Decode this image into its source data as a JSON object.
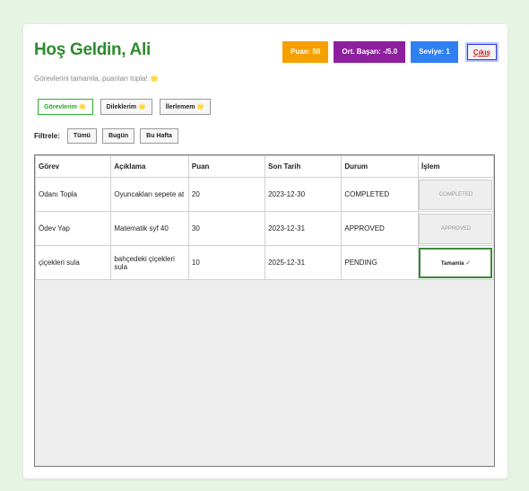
{
  "header": {
    "title": "Hoş Geldin, Ali",
    "subtitle": "Görevlerini tamamla, puanları topla! 🌟"
  },
  "badges": {
    "points": "Puan: 50",
    "avg_success": "Ort. Başarı: -/5.0",
    "level": "Seviye: 1",
    "logout": "Çıkış"
  },
  "tabs": [
    {
      "label": "Görevlerim 🌟",
      "active": true
    },
    {
      "label": "Dileklerim 🌟",
      "active": false
    },
    {
      "label": "İlerlemem 🌟",
      "active": false
    }
  ],
  "filter": {
    "label": "Filtrele:",
    "buttons": [
      "Tümü",
      "Bugün",
      "Bu Hafta"
    ]
  },
  "table": {
    "headers": [
      "Görev",
      "Açıklama",
      "Puan",
      "Son Tarih",
      "Durum",
      "İşlem"
    ],
    "rows": [
      {
        "task": "Odanı Topla",
        "description": "Oyuncakları sepete at",
        "points": "20",
        "due": "2023-12-30",
        "status": "COMPLETED",
        "action": "COMPLETED"
      },
      {
        "task": "Ödev Yap",
        "description": "Matematik syf 40",
        "points": "30",
        "due": "2023-12-31",
        "status": "APPROVED",
        "action": "APPROVED"
      },
      {
        "task": "çiçekleri sula",
        "description": "bahçedeki çiçekleri sula",
        "points": "10",
        "due": "2025-12-31",
        "status": "PENDING",
        "action": "Tamamla",
        "action_icon": "✓"
      }
    ]
  },
  "colors": {
    "title_green": "#2e8b2e",
    "points_badge": "#f5a000",
    "avg_badge": "#8e1f9e",
    "level_badge": "#2f80f0",
    "logout_text": "#d21a1a",
    "page_bg": "#e6f4e3"
  }
}
